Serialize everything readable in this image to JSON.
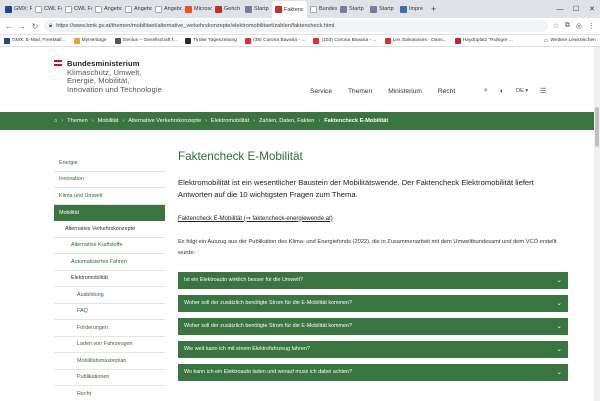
{
  "browser": {
    "tabs": [
      {
        "label": "GMX: Fr",
        "color": "#1c449b",
        "active": false
      },
      {
        "label": "CWL Fakt",
        "color": "#ffffff",
        "active": false
      },
      {
        "label": "CWL Fakt",
        "color": "#ffffff",
        "active": false
      },
      {
        "label": "Angebot Si",
        "color": "#ffffff",
        "active": false
      },
      {
        "label": "Angebot Si",
        "color": "#ffffff",
        "active": false
      },
      {
        "label": "Angebot Si",
        "color": "#ffffff",
        "active": false
      },
      {
        "label": "Microsoft",
        "color": "#f25022",
        "active": false
      },
      {
        "label": "Gerich",
        "color": "#cc2b2b",
        "active": false
      },
      {
        "label": "Startp",
        "color": "#7a7a9a",
        "active": false
      },
      {
        "label": "Faktenc",
        "color": "#cc2b2b",
        "active": true
      },
      {
        "label": "Bundesmin",
        "color": "#ffffff",
        "active": false
      },
      {
        "label": "Startp",
        "color": "#7a7a9a",
        "active": false
      },
      {
        "label": "Startp",
        "color": "#7a7a9a",
        "active": false
      },
      {
        "label": "Impre",
        "color": "#3c6ea8",
        "active": false
      }
    ],
    "tab_close": "✕",
    "new_tab": "+",
    "url": "https://www.bmk.gv.at/themen/mobilitaet/alternative_verkehrskonzepte/elektromobilitaet/zahlen/faktencheck.html",
    "bookmarks": [
      {
        "label": "GMX: E-Mail, FreeMail...",
        "color": "#1c449b"
      },
      {
        "label": "MyHeritage",
        "color": "#f0a030"
      },
      {
        "label": "Genius – Gesellschaft f...",
        "color": "#555555"
      },
      {
        "label": "Tiroler Tageszeitung",
        "color": "#2a2a2a"
      },
      {
        "label": "(38) Corona Bavaria - ...",
        "color": "#e52d27"
      },
      {
        "label": "(103) Corona Bavaria - ...",
        "color": "#e52d27"
      },
      {
        "label": "Les Salvatoises - Dans...",
        "color": "#e52d27"
      },
      {
        "label": "Haydnplatz \"Ruhiger ...",
        "color": "#c0282d"
      }
    ],
    "other_bookmarks": "Weitere Lesezeichen"
  },
  "site": {
    "logo_lines": [
      "Bundesministerium",
      "Klimaschutz, Umwelt,",
      "Energie, Mobilität,",
      "Innovation und Technologie"
    ],
    "nav": [
      "Service",
      "Themen",
      "Ministerium",
      "Recht"
    ],
    "lang": "DE",
    "flag_colors": [
      "#c8102e",
      "#ffffff",
      "#c8102e"
    ]
  },
  "breadcrumb": [
    "Themen",
    "Mobilität",
    "Alternative Verkehrskonzepte",
    "Elektromobilität",
    "Zahlen, Daten, Fakten",
    "Faktencheck E-Mobilität"
  ],
  "sidebar": [
    {
      "label": "Energie",
      "indent": 0,
      "active": false,
      "plain": false
    },
    {
      "label": "Innovation",
      "indent": 0,
      "active": false,
      "plain": false
    },
    {
      "label": "Klima und Umwelt",
      "indent": 0,
      "active": false,
      "plain": false
    },
    {
      "label": "Mobilität",
      "indent": 0,
      "active": true,
      "plain": false
    },
    {
      "label": "Alternative Verkehrskonzepte",
      "indent": 1,
      "active": false,
      "plain": true
    },
    {
      "label": "Alternative Kraftstoffe",
      "indent": 2,
      "active": false,
      "plain": false
    },
    {
      "label": "Automatisiertes Fahren",
      "indent": 2,
      "active": false,
      "plain": false
    },
    {
      "label": "Elektromobilität",
      "indent": 2,
      "active": false,
      "plain": true
    },
    {
      "label": "Ausbildung",
      "indent": 3,
      "active": false,
      "plain": false
    },
    {
      "label": "FAQ",
      "indent": 3,
      "active": false,
      "plain": false
    },
    {
      "label": "Förderungen",
      "indent": 3,
      "active": false,
      "plain": false
    },
    {
      "label": "Laden von Fahrzeugen",
      "indent": 3,
      "active": false,
      "plain": false
    },
    {
      "label": "Mobilitätsmasterplan",
      "indent": 3,
      "active": false,
      "plain": false
    },
    {
      "label": "Publikationen",
      "indent": 3,
      "active": false,
      "plain": false
    },
    {
      "label": "Recht",
      "indent": 3,
      "active": false,
      "plain": false
    }
  ],
  "main": {
    "title": "Faktencheck E-Mobilität",
    "lead": "Elektromobilität ist ein wesentlicher Baustein der Mobilitätswende. Der Faktencheck Elektromobilität liefert Antworten auf die 10 wichtigsten Fragen zum Thema.",
    "link": "Faktencheck E-Mobilität (⇒ faktencheck-energiewende.at)",
    "intro": "Es folgt ein Auszug aus der Publikation des Klima- und Energiefonds (2022), die in Zusammenarbeit mit dem Umweltbundesamt und dem VCÖ erstellt wurde:",
    "accordions": [
      "Ist ein Elektroauto wirklich besser für die Umwelt?",
      "Woher soll der zusätzlich benötigte Strom für die E-Mobilität kommen?",
      "Woher soll der zusätzlich benötigte Strom für die E-Mobilität kommen?",
      "Wie weit kann ich mit einem Elektrofahrzeug fahren?",
      "Wo kann ich ein Elektroauto laden und worauf muss ich dabei achten?"
    ]
  },
  "colors": {
    "brand_green": "#3a7440",
    "link_green": "#2f6e35"
  }
}
